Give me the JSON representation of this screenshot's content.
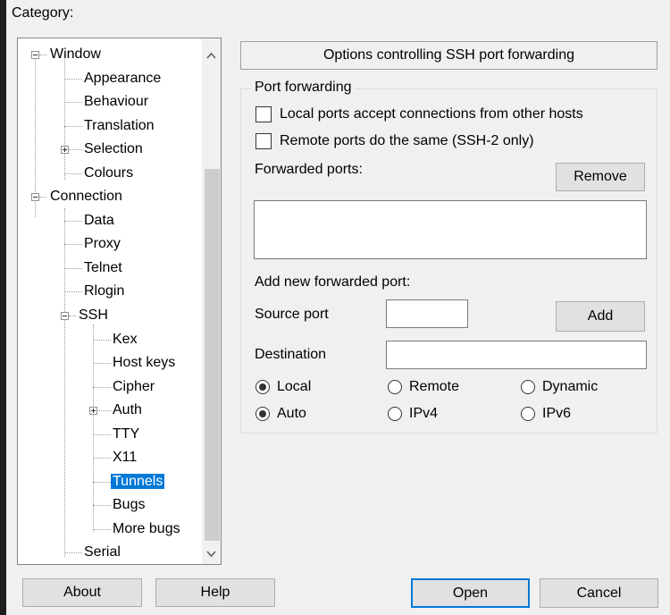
{
  "category_label": "Category:",
  "tree": {
    "window": "Window",
    "appearance": "Appearance",
    "behaviour": "Behaviour",
    "translation": "Translation",
    "selection": "Selection",
    "colours": "Colours",
    "connection": "Connection",
    "data": "Data",
    "proxy": "Proxy",
    "telnet": "Telnet",
    "rlogin": "Rlogin",
    "ssh": "SSH",
    "kex": "Kex",
    "host_keys": "Host keys",
    "cipher": "Cipher",
    "auth": "Auth",
    "tty": "TTY",
    "x11": "X11",
    "tunnels": "Tunnels",
    "bugs": "Bugs",
    "more_bugs": "More bugs",
    "serial": "Serial"
  },
  "panel": {
    "header": "Options controlling SSH port forwarding",
    "group_title": "Port forwarding",
    "local_ports_label": "Local ports accept connections from other hosts",
    "remote_ports_label": "Remote ports do the same (SSH-2 only)",
    "forwarded_ports_label": "Forwarded ports:",
    "remove_label": "Remove",
    "add_new_label": "Add new forwarded port:",
    "source_port_label": "Source port",
    "source_port_value": "",
    "add_label": "Add",
    "destination_label": "Destination",
    "destination_value": "",
    "direction": {
      "local": "Local",
      "remote": "Remote",
      "dynamic": "Dynamic",
      "selected": "Local"
    },
    "protocol": {
      "auto": "Auto",
      "ipv4": "IPv4",
      "ipv6": "IPv6",
      "selected": "Auto"
    }
  },
  "buttons": {
    "about": "About",
    "help": "Help",
    "open": "Open",
    "cancel": "Cancel"
  },
  "colors": {
    "selection": "#0078d7",
    "default_button_border": "#0078d7"
  }
}
